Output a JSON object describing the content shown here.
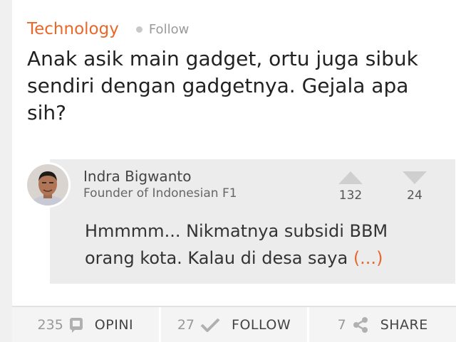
{
  "topic": {
    "label": "Technology",
    "follow_label": "Follow"
  },
  "question": {
    "text": "Anak asik main gadget, ortu juga sibuk sendiri dengan gadgetnya. Gejala apa sih?"
  },
  "answer": {
    "author_name": "Indra Bigwanto",
    "author_bio": "Founder of Indonesian F1",
    "upvotes": "132",
    "downvotes": "24",
    "text": "Hmmmm... Nikmatnya subsidi BBM orang kota. Kalau di desa saya",
    "more_label": "(...)"
  },
  "actions": [
    {
      "count": "235",
      "label": "OPINI",
      "icon": "comment-icon"
    },
    {
      "count": "27",
      "label": "FOLLOW",
      "icon": "check-icon"
    },
    {
      "count": "7",
      "label": "SHARE",
      "icon": "share-icon"
    }
  ],
  "colors": {
    "accent": "#e8682a",
    "icon_gray": "#b0b0b0"
  }
}
